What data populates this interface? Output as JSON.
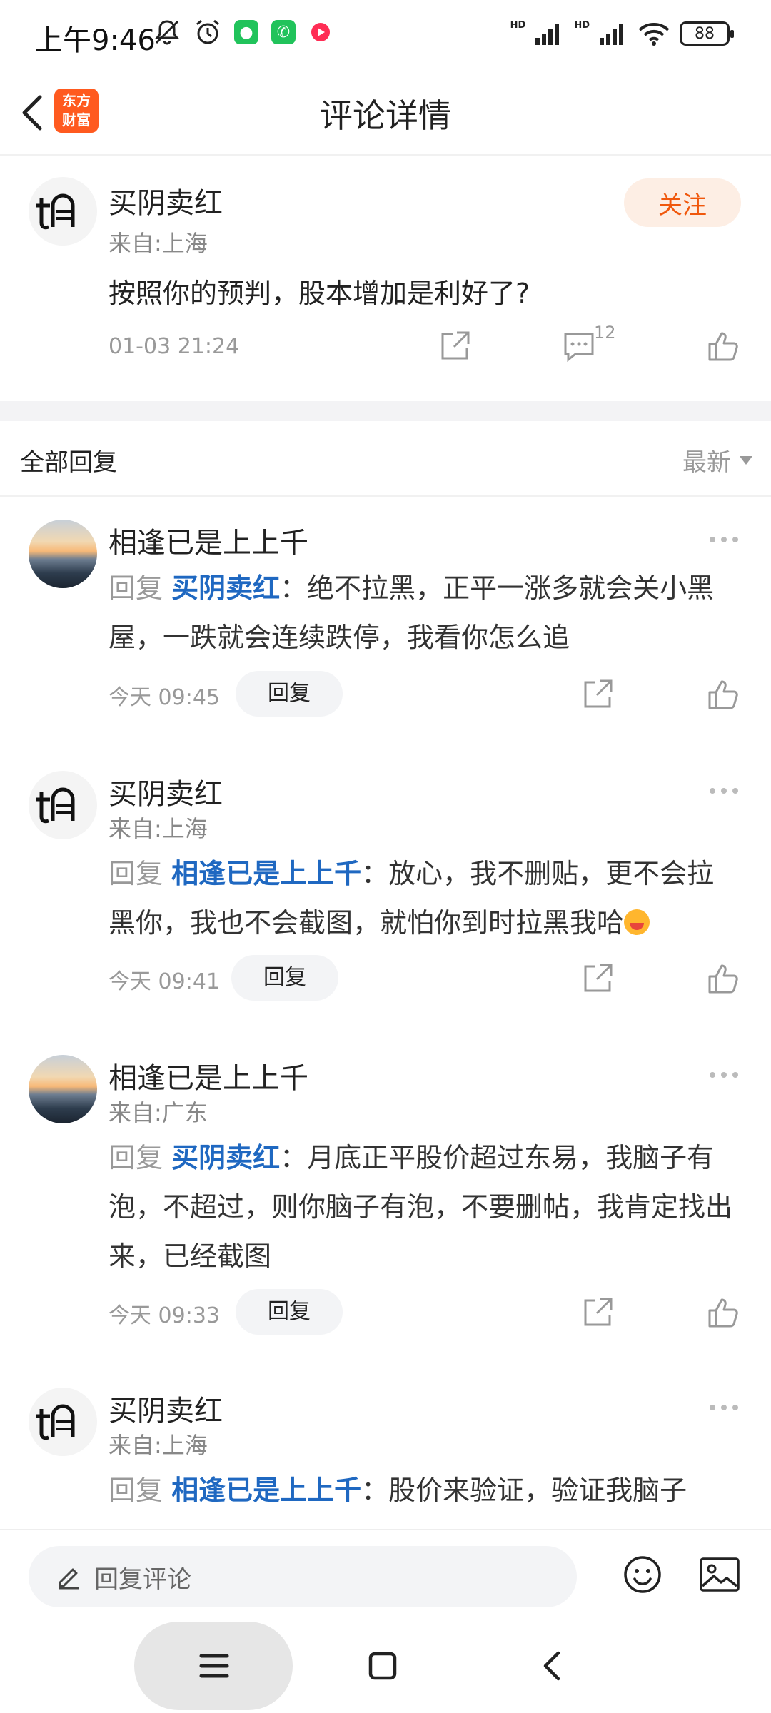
{
  "status_bar": {
    "time": "上午9:46",
    "battery": "88",
    "hd1": "HD",
    "hd2": "HD"
  },
  "header": {
    "title": "评论详情",
    "logo_line1": "东方",
    "logo_line2": "财富"
  },
  "post": {
    "author": "买阴卖红",
    "location": "来自:上海",
    "text": "按照你的预判，股本增加是利好了?",
    "time": "01-03 21:24",
    "comment_count": "12",
    "follow_label": "关注"
  },
  "replies_header": {
    "title": "全部回复",
    "sort_label": "最新"
  },
  "reply_prefix": "回复",
  "reply_button_label": "回复",
  "replies": [
    {
      "author": "相逢已是上上千",
      "location": "",
      "target": "买阴卖红",
      "text": "绝不拉黑，正平一涨多就会关小黑屋，一跌就会连续跌停，我看你怎么追",
      "time": "今天 09:45"
    },
    {
      "author": "买阴卖红",
      "location": "来自:上海",
      "target": "相逢已是上上千",
      "text": "放心，我不删贴，更不会拉黑你，我也不会截图，就怕你到时拉黑我哈",
      "time": "今天 09:41"
    },
    {
      "author": "相逢已是上上千",
      "location": "来自:广东",
      "target": "买阴卖红",
      "text": "月底正平股价超过东易，我脑子有泡，不超过，则你脑子有泡，不要删帖，我肯定找出来，已经截图",
      "time": "今天 09:33"
    },
    {
      "author": "买阴卖红",
      "location": "来自:上海",
      "target": "相逢已是上上千",
      "text": "股价来验证，验证我脑子"
    }
  ],
  "bottom_bar": {
    "placeholder": "回复评论"
  },
  "colors": {
    "accent": "#f0580d",
    "link_blue": "#1f68c1",
    "muted": "#999999"
  }
}
